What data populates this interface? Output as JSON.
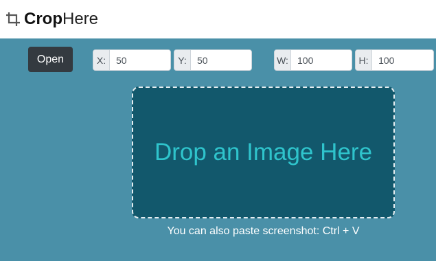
{
  "header": {
    "logo_icon": "crop-icon",
    "logo_bold": "Crop",
    "logo_light": "Here"
  },
  "toolbar": {
    "open_label": "Open",
    "x": {
      "label": "X:",
      "value": "50"
    },
    "y": {
      "label": "Y:",
      "value": "50"
    },
    "w": {
      "label": "W:",
      "value": "100"
    },
    "h": {
      "label": "H:",
      "value": "100"
    }
  },
  "dropzone": {
    "text": "Drop an Image Here"
  },
  "hint": "You can also paste screenshot: Ctrl + V",
  "colors": {
    "background": "#4a90a8",
    "header": "#ffffff",
    "button": "#343a40",
    "dropzone": "#12586c",
    "drop_text": "#2fc4cc"
  }
}
